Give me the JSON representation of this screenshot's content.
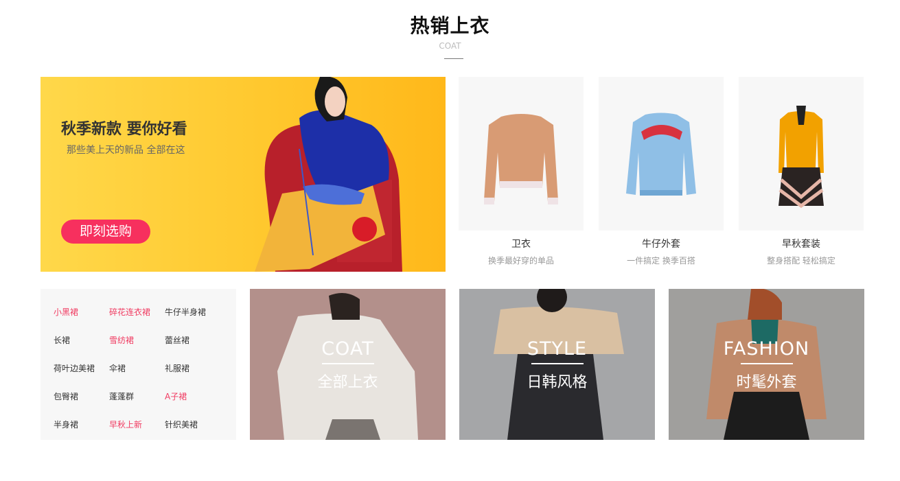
{
  "section": {
    "title": "热销上衣",
    "subtitle": "COAT"
  },
  "banner": {
    "title": "秋季新款 要你好看",
    "subtitle": "那些美上天的新品 全部在这",
    "button": "即刻选购"
  },
  "products": [
    {
      "name": "卫衣",
      "desc": "换季最好穿的单品",
      "icon": "sweatshirt-icon"
    },
    {
      "name": "牛仔外套",
      "desc": "一件搞定 换季百搭",
      "icon": "denim-jacket-icon"
    },
    {
      "name": "早秋套装",
      "desc": "整身搭配 轻松搞定",
      "icon": "autumn-set-icon"
    }
  ],
  "categories": [
    [
      {
        "label": "小黑裙",
        "hot": true
      },
      {
        "label": "碎花连衣裙",
        "hot": true
      },
      {
        "label": "牛仔半身裙",
        "hot": false
      }
    ],
    [
      {
        "label": "长裙",
        "hot": false
      },
      {
        "label": "雪纺裙",
        "hot": true
      },
      {
        "label": "蕾丝裙",
        "hot": false
      }
    ],
    [
      {
        "label": "荷叶边美裙",
        "hot": false
      },
      {
        "label": "伞裙",
        "hot": false
      },
      {
        "label": "礼服裙",
        "hot": false
      }
    ],
    [
      {
        "label": "包臀裙",
        "hot": false
      },
      {
        "label": "蓬蓬群",
        "hot": false
      },
      {
        "label": "A子裙",
        "hot": true
      }
    ],
    [
      {
        "label": "半身裙",
        "hot": false
      },
      {
        "label": "早秋上新",
        "hot": true
      },
      {
        "label": "针织美裙",
        "hot": false
      }
    ]
  ],
  "tiles": [
    {
      "en": "COAT",
      "cn": "全部上衣"
    },
    {
      "en": "STYLE",
      "cn": "日韩风格"
    },
    {
      "en": "FASHION",
      "cn": "时髦外套"
    }
  ],
  "colors": {
    "accent": "#f7305e",
    "hot_link": "#f03a60",
    "banner_bg": "#ffc82e"
  }
}
